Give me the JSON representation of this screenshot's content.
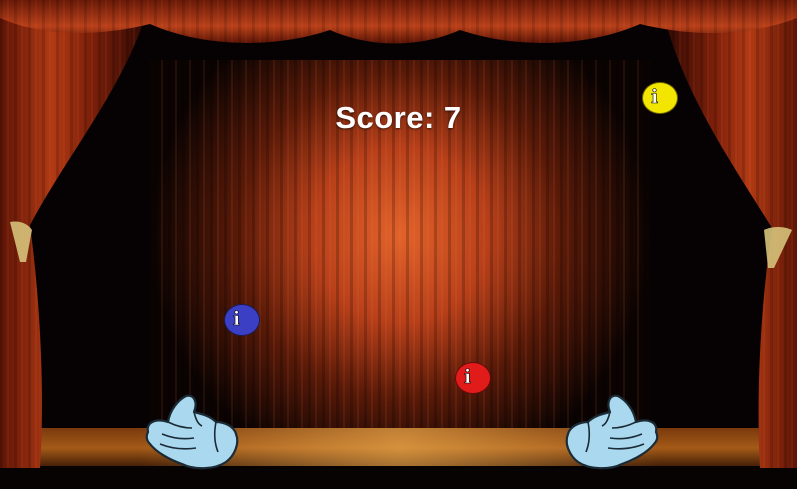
{
  "hud": {
    "score_label": "Score:",
    "score_value": "7"
  },
  "balls": [
    {
      "name": "yellow-ball",
      "color": "#f2e600",
      "glyph": "i"
    },
    {
      "name": "blue-ball",
      "color": "#3a3fc4",
      "glyph": "i"
    },
    {
      "name": "red-ball",
      "color": "#e11a1a",
      "glyph": "i"
    }
  ],
  "hands": [
    {
      "name": "left-hand",
      "color": "#a9d8ef"
    },
    {
      "name": "right-hand",
      "color": "#a9d8ef"
    }
  ],
  "colors": {
    "curtain": "#8e2a10",
    "curtain_highlight": "#c8481c",
    "spotlight": "#d9561e",
    "stage_floor": "#8a4a12",
    "tassel": "#d6c27a"
  }
}
